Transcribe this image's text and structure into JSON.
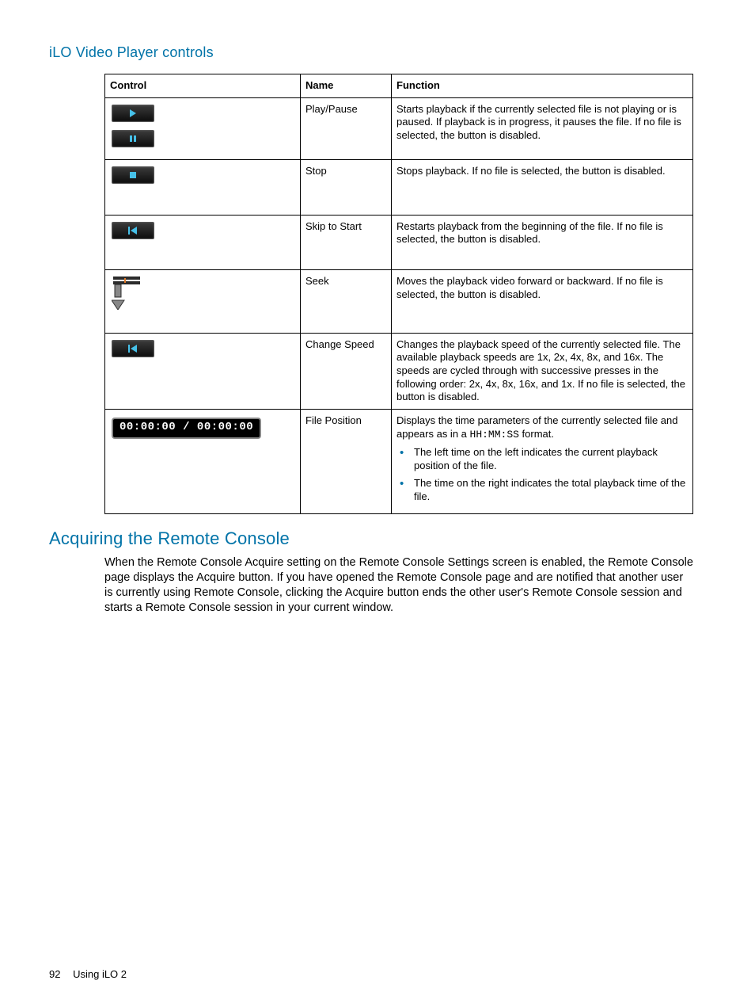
{
  "section_title": "iLO Video Player controls",
  "table": {
    "headers": {
      "control": "Control",
      "name": "Name",
      "function": "Function"
    },
    "rows": [
      {
        "control_icon": "play-pause",
        "name": "Play/Pause",
        "function": "Starts playback if the currently selected file is not playing or is paused. If playback is in progress, it pauses the file. If no file is selected, the button is disabled."
      },
      {
        "control_icon": "stop",
        "name": "Stop",
        "function": "Stops playback. If no file is selected, the button is disabled."
      },
      {
        "control_icon": "skip-to-start",
        "name": "Skip to Start",
        "function": "Restarts playback from the beginning of the file. If no file is selected, the button is disabled."
      },
      {
        "control_icon": "seek-slider",
        "name": "Seek",
        "function": "Moves the playback video forward or backward. If no file is selected, the button is disabled."
      },
      {
        "control_icon": "change-speed",
        "name": "Change Speed",
        "function": "Changes the playback speed of the currently selected file. The available playback speeds are 1x, 2x, 4x, 8x, and 16x. The speeds are cycled through with successive presses in the following order: 2x, 4x, 8x, 16x, and 1x. If no file is selected, the button is disabled."
      },
      {
        "control_icon": "file-position",
        "time_display": "00:00:00 / 00:00:00",
        "name": "File Position",
        "function_intro_a": "Displays the time parameters of the currently selected file and appears as in a ",
        "function_intro_code": "HH:MM:SS",
        "function_intro_b": " format.",
        "bullets": [
          "The left time on the left indicates the current playback position of the file.",
          "The time on the right indicates the total playback time of the file."
        ]
      }
    ]
  },
  "heading2": "Acquiring the Remote Console",
  "paragraph": "When the Remote Console Acquire setting on the Remote Console Settings screen is enabled, the Remote Console page displays the Acquire button. If you have opened the Remote Console page and are notified that another user is currently using Remote Console, clicking the Acquire button ends the other user's Remote Console session and starts a Remote Console session in your current window.",
  "footer": {
    "page": "92",
    "section": "Using iLO 2"
  }
}
